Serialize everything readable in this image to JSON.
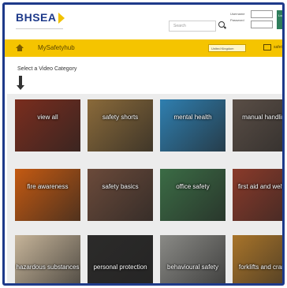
{
  "header": {
    "logo_text": "BHSEA",
    "search_placeholder": "Search",
    "login_username_label": "Username",
    "login_password_label": "Password",
    "login_button": "Login"
  },
  "nav": {
    "home_label": "MySafetyhub",
    "region_select": "United Kingdom",
    "folder_label": "safetyhub"
  },
  "main": {
    "select_prompt": "Select a Video Category"
  },
  "tiles": [
    {
      "label": "view all",
      "color": "#7a2d1e"
    },
    {
      "label": "safety shorts",
      "color": "#8a6a3a"
    },
    {
      "label": "mental health",
      "color": "#2f7fb0"
    },
    {
      "label": "manual handling",
      "color": "#5a4e46"
    },
    {
      "label": "fire awareness",
      "color": "#c45a12"
    },
    {
      "label": "safety basics",
      "color": "#6b4a3a"
    },
    {
      "label": "office safety",
      "color": "#3b6c45"
    },
    {
      "label": "first aid and welfare",
      "color": "#8a3a2a"
    },
    {
      "label": "hazardous substances",
      "color": "#c6b499"
    },
    {
      "label": "personal protection",
      "color": "#2c2b2a"
    },
    {
      "label": "behavioural safety",
      "color": "#8a8a86"
    },
    {
      "label": "forklifts and cranes",
      "color": "#a8742a"
    }
  ]
}
